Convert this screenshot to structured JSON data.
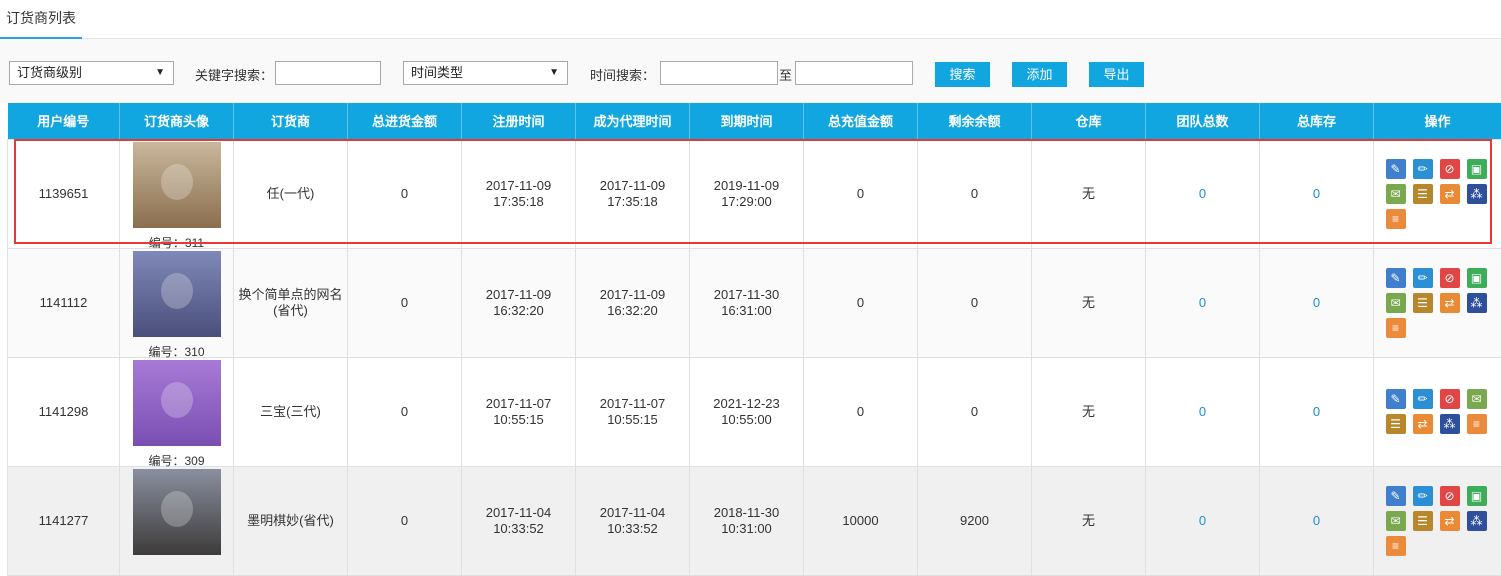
{
  "tab": {
    "label": "订货商列表"
  },
  "filters": {
    "level_select": "订货商级别",
    "keyword_label": "关键字搜索：",
    "time_type_select": "时间类型",
    "time_label": "时间搜索：",
    "to_label": "至",
    "search_button": "搜索",
    "add_button": "添加",
    "export_button": "导出"
  },
  "columns": [
    "用户编号",
    "订货商头像",
    "订货商",
    "总进货金额",
    "注册时间",
    "成为代理时间",
    "到期时间",
    "总充值金额",
    "剩余余额",
    "仓库",
    "团队总数",
    "总库存",
    "操作"
  ],
  "rows": [
    {
      "user_id": "1139651",
      "avatar_no": "编号：311",
      "name": "任(一代)",
      "total_purchase": "0",
      "reg_date": "2017-11-09",
      "reg_time": "17:35:18",
      "agent_date": "2017-11-09",
      "agent_time": "17:35:18",
      "expire_date": "2019-11-09",
      "expire_time": "17:29:00",
      "total_recharge": "0",
      "balance": "0",
      "warehouse": "无",
      "team_total": "0",
      "total_stock": "0",
      "avatar_colors": [
        "#c9b79c",
        "#8a6f4e"
      ],
      "ops": [
        "edit-doc",
        "pencil",
        "ban",
        "qr",
        "money",
        "list",
        "transfer",
        "boxes",
        "note-clock"
      ]
    },
    {
      "user_id": "1141112",
      "avatar_no": "编号：310",
      "name": "换个简单点的网名(省代)",
      "total_purchase": "0",
      "reg_date": "2017-11-09",
      "reg_time": "16:32:20",
      "agent_date": "2017-11-09",
      "agent_time": "16:32:20",
      "expire_date": "2017-11-30",
      "expire_time": "16:31:00",
      "total_recharge": "0",
      "balance": "0",
      "warehouse": "无",
      "team_total": "0",
      "total_stock": "0",
      "avatar_colors": [
        "#7f89b7",
        "#4b4f7c"
      ],
      "ops": [
        "edit-doc",
        "pencil",
        "ban",
        "qr",
        "money",
        "list",
        "transfer",
        "boxes",
        "note-clock"
      ]
    },
    {
      "user_id": "1141298",
      "avatar_no": "编号：309",
      "name": "三宝(三代)",
      "total_purchase": "0",
      "reg_date": "2017-11-07",
      "reg_time": "10:55:15",
      "agent_date": "2017-11-07",
      "agent_time": "10:55:15",
      "expire_date": "2021-12-23",
      "expire_time": "10:55:00",
      "total_recharge": "0",
      "balance": "0",
      "warehouse": "无",
      "team_total": "0",
      "total_stock": "0",
      "avatar_colors": [
        "#a77ad6",
        "#7a4fb3"
      ],
      "ops": [
        "edit-doc",
        "pencil",
        "ban",
        "money",
        "list",
        "transfer",
        "boxes",
        "note-clock"
      ]
    },
    {
      "user_id": "1141277",
      "avatar_no": "",
      "name": "墨明棋妙(省代)",
      "total_purchase": "0",
      "reg_date": "2017-11-04",
      "reg_time": "10:33:52",
      "agent_date": "2017-11-04",
      "agent_time": "10:33:52",
      "expire_date": "2018-11-30",
      "expire_time": "10:31:00",
      "total_recharge": "10000",
      "balance": "9200",
      "warehouse": "无",
      "team_total": "0",
      "total_stock": "0",
      "avatar_colors": [
        "#8a8f9f",
        "#3d3b3a"
      ],
      "ops": [
        "edit-doc",
        "pencil",
        "ban",
        "qr",
        "money",
        "list",
        "transfer",
        "boxes",
        "note-clock"
      ]
    }
  ],
  "op_colors": {
    "edit-doc": "#3f7fce",
    "pencil": "#2b8fd6",
    "ban": "#e04646",
    "qr": "#3dad5a",
    "money": "#7aa84f",
    "list": "#b8862b",
    "transfer": "#ea8a35",
    "boxes": "#2e4f9c",
    "note-clock": "#ec8a3c"
  },
  "op_glyphs": {
    "edit-doc": "✎",
    "pencil": "✏",
    "ban": "⊘",
    "qr": "▣",
    "money": "✉",
    "list": "☰",
    "transfer": "⇄",
    "boxes": "⁂",
    "note-clock": "≡"
  }
}
